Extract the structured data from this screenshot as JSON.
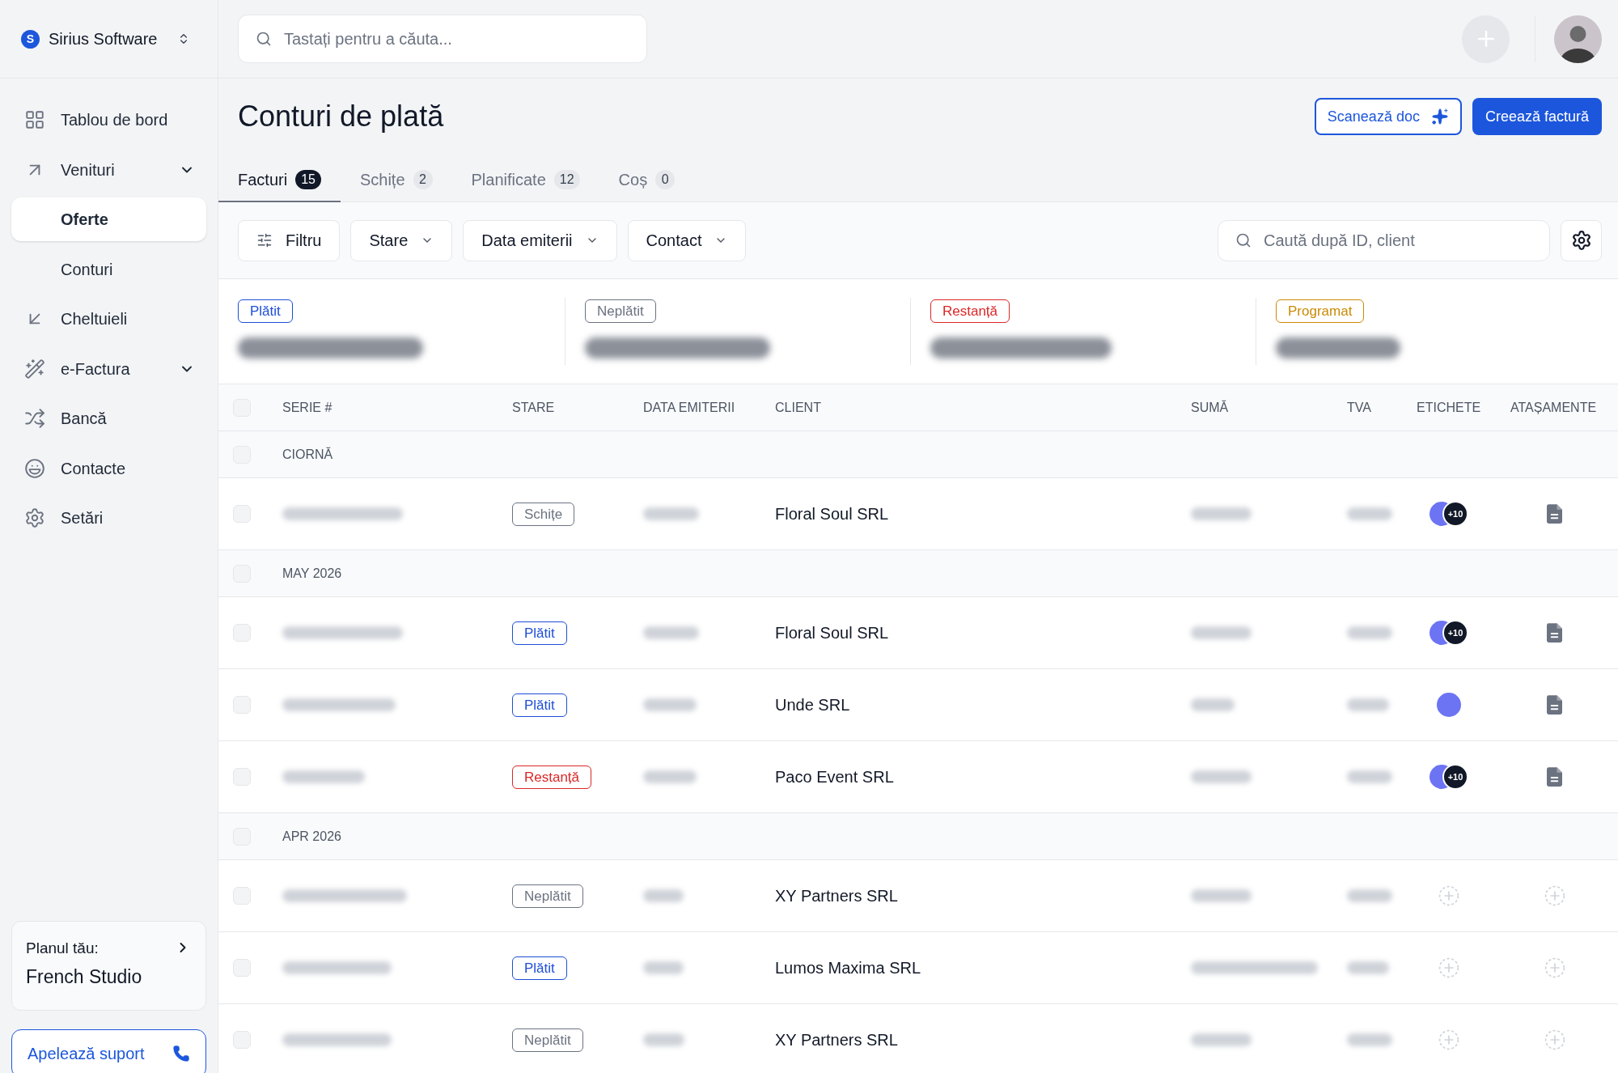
{
  "sidebar": {
    "brand": {
      "logo": "S",
      "name": "Sirius Software"
    },
    "items": [
      {
        "label": "Tablou de bord",
        "kind": "link",
        "selected": false
      },
      {
        "label": "Venituri",
        "kind": "group",
        "selected": false,
        "children": [
          {
            "label": "Oferte",
            "selected": true
          },
          {
            "label": "Conturi",
            "selected": false
          }
        ]
      },
      {
        "label": "Cheltuieli",
        "kind": "link",
        "selected": false
      },
      {
        "label": "e-Factura",
        "kind": "group",
        "selected": false
      },
      {
        "label": "Bancă",
        "kind": "link",
        "selected": false
      },
      {
        "label": "Contacte",
        "kind": "link",
        "selected": false
      },
      {
        "label": "Setări",
        "kind": "link",
        "selected": false
      }
    ],
    "plan": {
      "label": "Planul tău:",
      "name": "French Studio"
    },
    "support_button": "Apelează suport"
  },
  "header": {
    "search": {
      "placeholder": "Tastați pentru a căuta..."
    }
  },
  "page": {
    "title": "Conturi de plată",
    "actions": [
      {
        "label": "Scanează doc",
        "kind": "outline"
      },
      {
        "label": "Creează factură",
        "kind": "primary"
      }
    ],
    "tabs": [
      {
        "label": "Facturi",
        "count": "15",
        "selected": true
      },
      {
        "label": "Schițe",
        "count": "2",
        "selected": false
      },
      {
        "label": "Planificate",
        "count": "12",
        "selected": false
      },
      {
        "label": "Coș",
        "count": "0",
        "selected": false
      }
    ],
    "filters": [
      {
        "label": "Filtru",
        "kind": "filter"
      },
      {
        "label": "Stare",
        "kind": "dropdown"
      },
      {
        "label": "Data emiterii",
        "kind": "dropdown"
      },
      {
        "label": "Contact",
        "kind": "dropdown"
      }
    ],
    "search": {
      "placeholder": "Caută după ID, client"
    },
    "summary": [
      {
        "status": "Plătit",
        "color": "#1d4ed8"
      },
      {
        "status": "Neplătit",
        "color": "#6b7280"
      },
      {
        "status": "Restanță",
        "color": "#dc2626"
      },
      {
        "status": "Programat",
        "color": "#ca8a04"
      }
    ]
  },
  "table": {
    "header_checked": false,
    "columns": [
      "SERIE #",
      "STARE",
      "DATA EMITERII",
      "CLIENT",
      "SUMĂ",
      "TVA",
      "ETICHETE",
      "ATAȘAMENTE"
    ],
    "groups": [
      {
        "label": "CIORNĂ",
        "checked": false,
        "rows": [
          {
            "checked": false,
            "status": {
              "label": "Schițe",
              "color": "#6b7280"
            },
            "client": "Floral Soul SRL",
            "tags": [
              {
                "color": "#6c74f4"
              }
            ],
            "tags_more": "+10",
            "attachment": true
          }
        ]
      },
      {
        "label": "MAY 2026",
        "checked": false,
        "rows": [
          {
            "checked": false,
            "status": {
              "label": "Plătit",
              "color": "#1d4ed8"
            },
            "client": "Floral Soul SRL",
            "tags": [
              {
                "color": "#6c74f4"
              }
            ],
            "tags_more": "+10",
            "attachment": true
          },
          {
            "checked": false,
            "status": {
              "label": "Plătit",
              "color": "#1d4ed8"
            },
            "client": "Unde SRL",
            "tags": [
              {
                "color": "#6c74f4"
              }
            ],
            "attachment": true
          },
          {
            "checked": false,
            "status": {
              "label": "Restanță",
              "color": "#dc2626"
            },
            "client": "Paco Event SRL",
            "tags": [
              {
                "color": "#6c74f4"
              }
            ],
            "tags_more": "+10",
            "attachment": true
          }
        ]
      },
      {
        "label": "APR 2026",
        "checked": false,
        "rows": [
          {
            "checked": false,
            "status": {
              "label": "Neplătit",
              "color": "#6b7280"
            },
            "client": "XY Partners SRL",
            "attachment": false
          },
          {
            "checked": false,
            "status": {
              "label": "Plătit",
              "color": "#1d4ed8"
            },
            "client": "Lumos Maxima SRL",
            "attachment": false
          },
          {
            "checked": false,
            "status": {
              "label": "Neplătit",
              "color": "#6b7280"
            },
            "client": "XY Partners SRL",
            "attachment": false
          }
        ]
      }
    ]
  }
}
